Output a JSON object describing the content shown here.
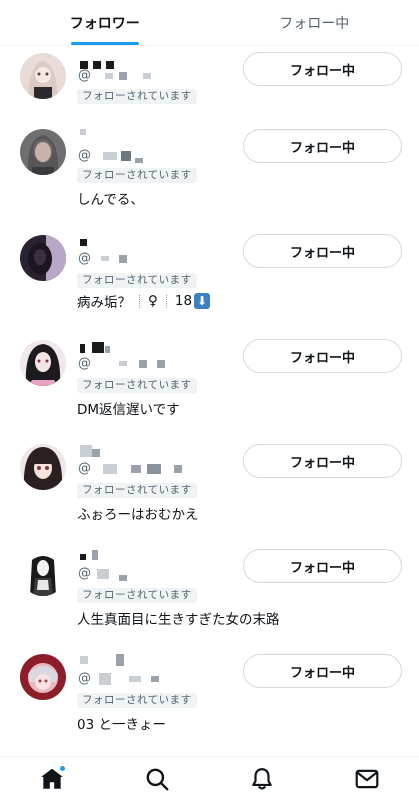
{
  "tabs": [
    {
      "label": "フォロワー"
    },
    {
      "label": "フォロー中"
    }
  ],
  "users": [
    {
      "at": "@",
      "badge": "フォローされています",
      "bio": "",
      "button": "フォロー中"
    },
    {
      "at": "@",
      "badge": "フォローされています",
      "bio": "しんでる、",
      "button": "フォロー中"
    },
    {
      "at": "@",
      "badge": "フォローされています",
      "bio": "病み垢？",
      "bio_symbol": "♀",
      "bio_number": "18",
      "bio_emoji": "⬇",
      "button": "フォロー中"
    },
    {
      "at": "@",
      "badge": "フォローされています",
      "bio": "DM返信遅いです",
      "button": "フォロー中"
    },
    {
      "at": "@",
      "badge": "フォローされています",
      "bio": "ふぉろーはおむかえ",
      "button": "フォロー中"
    },
    {
      "at": "@",
      "badge": "フォローされています",
      "bio": "人生真面目に生きすぎた女の末路",
      "button": "フォロー中"
    },
    {
      "at": "@",
      "badge": "フォローされています",
      "bio": "03 と一きょー",
      "button": "フォロー中"
    }
  ],
  "nav": [
    {
      "icon": "home-icon",
      "notification_dot": true
    },
    {
      "icon": "search-icon"
    },
    {
      "icon": "bell-icon"
    },
    {
      "icon": "mail-icon"
    }
  ],
  "colors": {
    "accent": "#1d9bf0",
    "text": "#0f1419",
    "muted": "#536471"
  }
}
